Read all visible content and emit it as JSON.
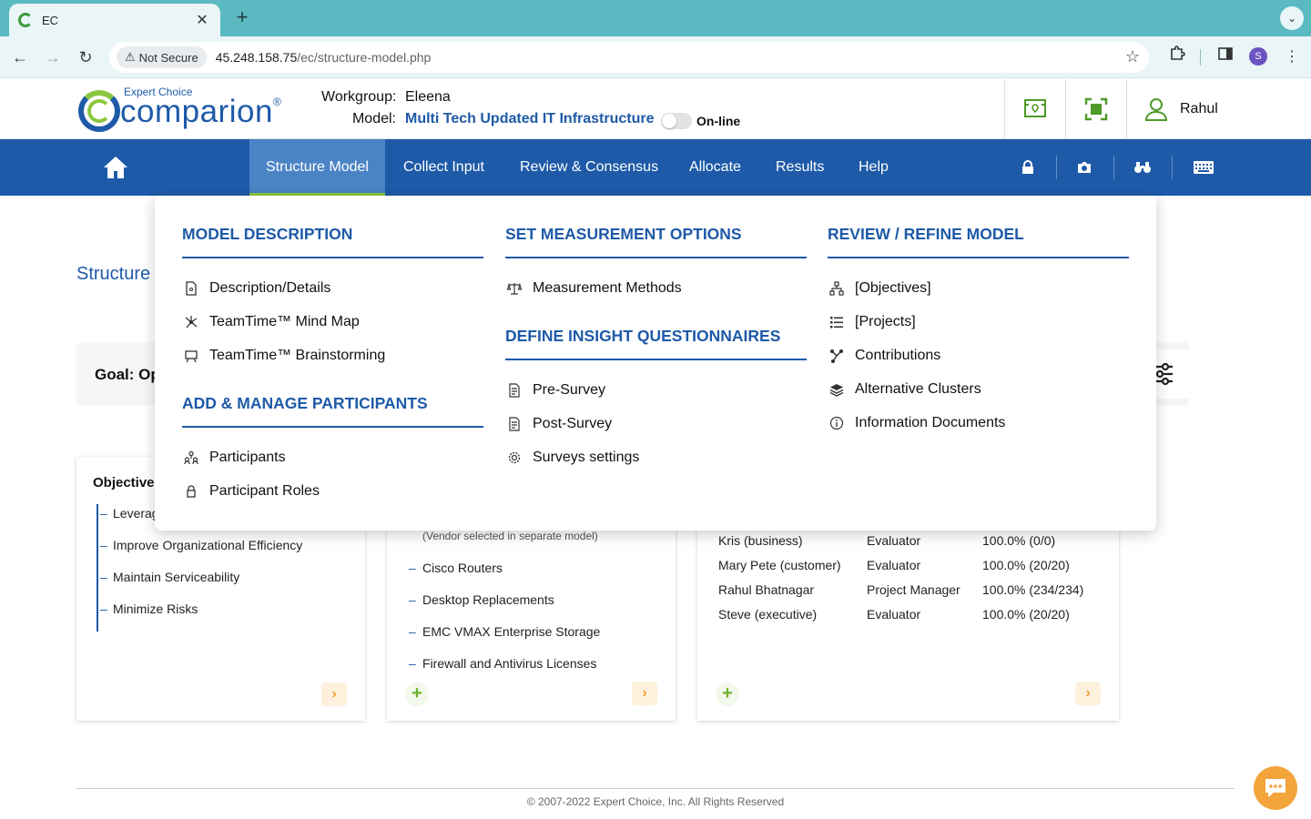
{
  "browser": {
    "tab_title": "EC",
    "not_secure_label": "Not Secure",
    "url_host": "45.248.158.75",
    "url_path": "/ec/structure-model.php",
    "profile_initial": "S"
  },
  "header": {
    "logo_sub": "Expert Choice",
    "logo_main": "comparion",
    "logo_reg": "®",
    "workgroup_label": "Workgroup:",
    "workgroup_value": "Eleena",
    "model_label": "Model:",
    "model_value": "Multi Tech Updated IT Infrastructure",
    "online_label": "On-line",
    "user_name": "Rahul"
  },
  "nav": {
    "items": [
      {
        "label": "Structure Model"
      },
      {
        "label": "Collect Input"
      },
      {
        "label": "Review & Consensus"
      },
      {
        "label": "Allocate"
      },
      {
        "label": "Results"
      },
      {
        "label": "Help"
      }
    ]
  },
  "page": {
    "title": "Structure",
    "goal": "Goal: Op",
    "objectives_title": "Objective",
    "objectives": [
      "Leverag",
      "Improve Organizational Efficiency",
      "Maintain Serviceability",
      "Minimize Risks"
    ],
    "alternatives_note": "(Vendor selected in separate model)",
    "alternatives": [
      "Cisco Routers",
      "Desktop Replacements",
      "EMC VMAX Enterprise Storage",
      "Firewall and Antivirus Licenses"
    ],
    "participants": [
      {
        "name": "Kris (business)",
        "role": "Evaluator",
        "progress": "100.0% (0/0)"
      },
      {
        "name": "Mary Pete (customer)",
        "role": "Evaluator",
        "progress": "100.0% (20/20)"
      },
      {
        "name": "Rahul Bhatnagar",
        "role": "Project Manager",
        "progress": "100.0% (234/234)"
      },
      {
        "name": "Steve (executive)",
        "role": "Evaluator",
        "progress": "100.0% (20/20)"
      }
    ],
    "footer": "© 2007-2022 Expert Choice, Inc. All Rights Reserved"
  },
  "menu": {
    "col1": {
      "head1": "MODEL DESCRIPTION",
      "items1": [
        "Description/Details",
        "TeamTime™ Mind Map",
        "TeamTime™ Brainstorming"
      ],
      "head2": "ADD & MANAGE PARTICIPANTS",
      "items2": [
        "Participants",
        "Participant Roles"
      ]
    },
    "col2": {
      "head1": "SET MEASUREMENT OPTIONS",
      "items1": [
        "Measurement Methods"
      ],
      "head2": "DEFINE INSIGHT QUESTIONNAIRES",
      "items2": [
        "Pre-Survey",
        "Post-Survey",
        "Surveys settings"
      ]
    },
    "col3": {
      "head1": "REVIEW / REFINE MODEL",
      "items1": [
        "[Objectives]",
        "[Projects]",
        "Contributions",
        "Alternative Clusters",
        "Information Documents"
      ]
    }
  },
  "colors": {
    "brand_blue": "#1e5aa8",
    "accent_green": "#8cc63f",
    "chrome_teal": "#5bb9c2",
    "chat_orange": "#f3a43a"
  }
}
